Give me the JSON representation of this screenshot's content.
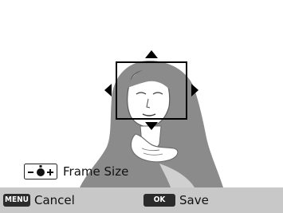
{
  "adjust_label": "Frame Size",
  "bottom_bar": {
    "menu_key": "MENU",
    "cancel_label": "Cancel",
    "ok_key": "OK",
    "save_label": "Save"
  },
  "colors": {
    "frame": "#000000",
    "silhouette": "#8a8a8a",
    "bar": "#c8c8c8"
  }
}
